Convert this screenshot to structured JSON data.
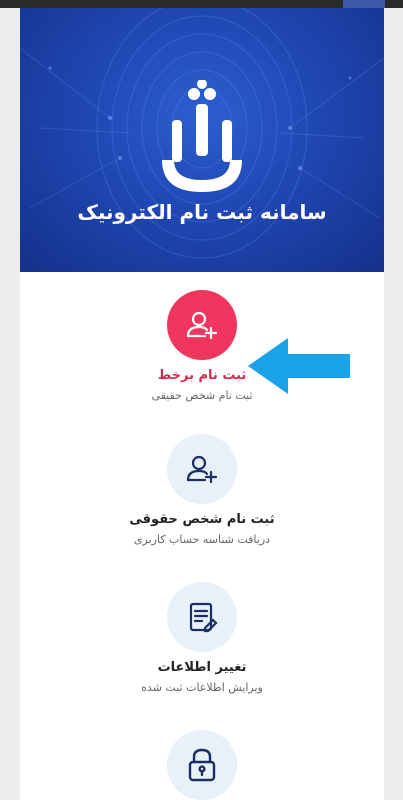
{
  "header": {
    "title": "سامانه ثبت نام الکترونیک"
  },
  "menu": {
    "items": [
      {
        "label": "ثبت نام برخط",
        "sub": "ثبت نام شخص حقیقی",
        "icon": "add-user-icon",
        "color": "#f0365f",
        "label_color": "#d8294f"
      },
      {
        "label": "ثبت نام شخص حقوقی",
        "sub": "دریافت شناسه حساب کاربری",
        "icon": "add-user-icon",
        "color": "#e8f0fa",
        "label_color": "#222222"
      },
      {
        "label": "تغییر اطلاعات",
        "sub": "ویرایش اطلاعات ثبت شده",
        "icon": "edit-document-icon",
        "color": "#e8f0fa",
        "label_color": "#222222"
      },
      {
        "label": "",
        "sub": "",
        "icon": "lock-icon",
        "color": "#e8f0fa",
        "label_color": "#222222"
      }
    ]
  },
  "colors": {
    "hero_blue": "#1f47b3",
    "accent_red": "#f0365f",
    "annotation_arrow": "#1aa3e8",
    "icon_dark": "#1b2f63"
  }
}
